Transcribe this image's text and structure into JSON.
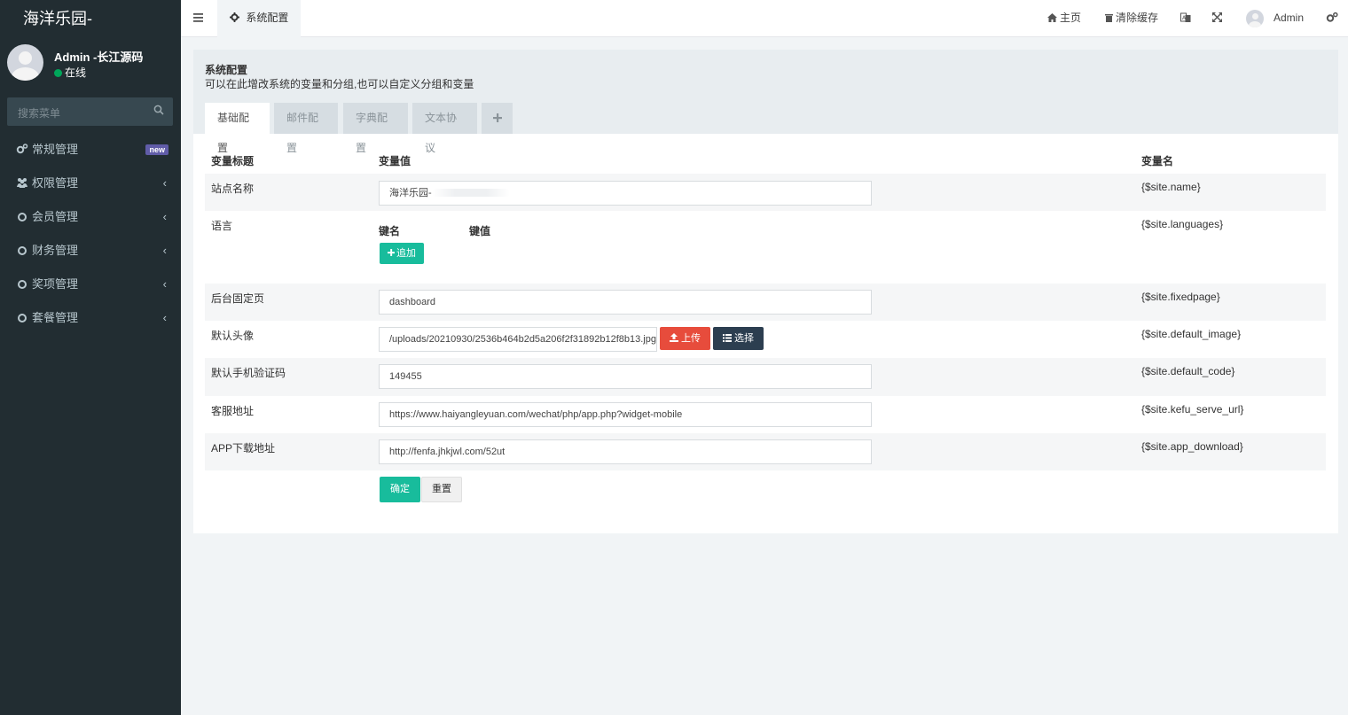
{
  "sidebar": {
    "brand": "海洋乐园-",
    "user_name": "Admin -长江源码",
    "status": "在线",
    "search_placeholder": "搜索菜单",
    "badge_new": "new",
    "menu": [
      {
        "label": "常规管理",
        "icon": "cogs-icon"
      },
      {
        "label": "权限管理",
        "icon": "users-icon"
      },
      {
        "label": "会员管理",
        "icon": "circle-o-icon"
      },
      {
        "label": "财务管理",
        "icon": "circle-o-icon"
      },
      {
        "label": "奖项管理",
        "icon": "circle-o-icon"
      },
      {
        "label": "套餐管理",
        "icon": "circle-o-icon"
      }
    ]
  },
  "topbar": {
    "tab_label": "系统配置",
    "home": "主页",
    "clear_cache": "清除缓存",
    "user": "Admin"
  },
  "panel": {
    "title": "系统配置",
    "desc": "可以在此增改系统的变量和分组,也可以自定义分组和变量",
    "tabs": [
      "基础配置",
      "邮件配置",
      "字典配置",
      "文本协议"
    ],
    "headers": {
      "title": "变量标题",
      "value": "变量值",
      "name": "变量名"
    },
    "rows": [
      {
        "label": "站点名称",
        "value": "海洋乐园-",
        "var": "{$site.name}"
      },
      {
        "label": "语言",
        "var": "{$site.languages}",
        "key_head": "键名",
        "val_head": "键值",
        "add_btn": "追加"
      },
      {
        "label": "后台固定页",
        "value": "dashboard",
        "var": "{$site.fixedpage}"
      },
      {
        "label": "默认头像",
        "value": "/uploads/20210930/2536b464b2d5a206f2f31892b12f8b13.jpg",
        "var": "{$site.default_image}",
        "upload_btn": "上传",
        "select_btn": "选择"
      },
      {
        "label": "默认手机验证码",
        "value": "149455",
        "var": "{$site.default_code}"
      },
      {
        "label": "客服地址",
        "value": "https://www.haiyangleyuan.com/wechat/php/app.php?widget-mobile",
        "var": "{$site.kefu_serve_url}"
      },
      {
        "label": "APP下载地址",
        "value": " http://fenfa.jhkjwl.com/52ut",
        "var": "{$site.app_download}"
      }
    ],
    "submit": "确定",
    "reset": "重置"
  }
}
